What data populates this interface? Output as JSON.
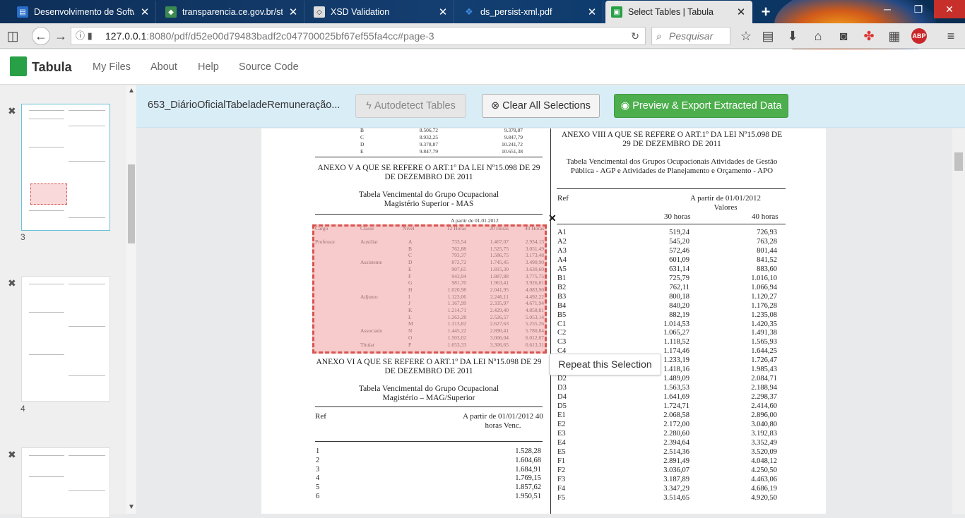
{
  "browser": {
    "tabs": [
      {
        "title": "Desenvolvimento de Softwa",
        "close": "✕"
      },
      {
        "title": "transparencia.ce.gov.br/stat",
        "close": "✕"
      },
      {
        "title": "XSD Validation",
        "close": "✕"
      },
      {
        "title": "ds_persist-xml.pdf",
        "close": "✕"
      },
      {
        "title": "Select Tables | Tabula",
        "close": "✕"
      }
    ],
    "new_tab": "+",
    "url_host": "127.0.0.1",
    "url_rest": ":8080/pdf/d52e00d79483badf2c047700025bf67ef55fa4cc#page-3",
    "search_placeholder": "Pesquisar",
    "abp": "ABP"
  },
  "app": {
    "brand": "Tabula",
    "menu": [
      "My Files",
      "About",
      "Help",
      "Source Code"
    ]
  },
  "toolbar": {
    "filename": "653_DiárioOficialTabeladeRemuneração...",
    "autodetect": "Autodetect Tables",
    "clear": "Clear All Selections",
    "export": "Preview & Export Extracted Data"
  },
  "sidebar": {
    "pages": [
      "3",
      "4"
    ]
  },
  "selection": {
    "close": "✕",
    "repeat": "Repeat this Selection"
  },
  "doc": {
    "left": {
      "top_rows": [
        [
          "B",
          "8.506,72",
          "9.378,87"
        ],
        [
          "C",
          "8.932,25",
          "9.847,79"
        ],
        [
          "D",
          "9.378,87",
          "10.241,72"
        ],
        [
          "E",
          "9.847,79",
          "10.651,38"
        ]
      ],
      "annex5_title": "ANEXO V A QUE SE REFERE O ART.1º DA LEI Nº15.098 DE 29 DE DEZEMBRO DE 2011",
      "annex5_sub": "Tabela Vencimental do Grupo Ocupacional Magistério Superior - MAS",
      "date_label": "A partir de 01.01.2012",
      "mas_headers": [
        "Cargo",
        "Classe",
        "Nível",
        "12 Horas",
        "20 Horas",
        "40 Horas"
      ],
      "mas_rows": [
        [
          "Professor",
          "Auxiliar",
          "A",
          "733,54",
          "1.467,07",
          "2.934,13"
        ],
        [
          "",
          "",
          "B",
          "762,88",
          "1.525,75",
          "3.051,49"
        ],
        [
          "",
          "",
          "C",
          "793,37",
          "1.586,75",
          "3.173,48"
        ],
        [
          "",
          "Assistente",
          "D",
          "872,72",
          "1.745,45",
          "3.490,90"
        ],
        [
          "",
          "",
          "E",
          "907,65",
          "1.815,30",
          "3.630,60"
        ],
        [
          "",
          "",
          "F",
          "943,94",
          "1.887,88",
          "3.775,75"
        ],
        [
          "",
          "",
          "G",
          "981,70",
          "1.963,41",
          "3.926,81"
        ],
        [
          "",
          "",
          "H",
          "1.020,98",
          "2.041,95",
          "4.083,90"
        ],
        [
          "",
          "Adjunto",
          "I",
          "1.123,06",
          "2.246,11",
          "4.492,22"
        ],
        [
          "",
          "",
          "J",
          "1.167,99",
          "2.335,97",
          "4.671,94"
        ],
        [
          "",
          "",
          "K",
          "1.214,71",
          "2.429,40",
          "4.858,81"
        ],
        [
          "",
          "",
          "L",
          "1.263,28",
          "2.526,57",
          "5.053,14"
        ],
        [
          "",
          "",
          "M",
          "1.313,82",
          "2.627,63",
          "5.255,26"
        ],
        [
          "",
          "Associado",
          "N",
          "1.445,22",
          "2.890,41",
          "5.780,84"
        ],
        [
          "",
          "",
          "O",
          "1.503,02",
          "3.006,04",
          "6.012,07"
        ],
        [
          "",
          "Titular",
          "P",
          "1.653,33",
          "3.306,65",
          "6.613,31"
        ]
      ],
      "annex6_title": "ANEXO VI A QUE SE REFERE O ART.1º DA LEI Nº15.098 DE 29 DE DEZEMBRO DE 2011",
      "annex6_sub": "Tabela Vencimental do Grupo Ocupacional Magistério – MAG/Superior",
      "mag_ref": "Ref",
      "mag_head": "A partir de 01/01/2012 40 horas Venc.",
      "mag_rows": [
        [
          "1",
          "1.528,28"
        ],
        [
          "2",
          "1.604,68"
        ],
        [
          "3",
          "1.684,91"
        ],
        [
          "4",
          "1.769,15"
        ],
        [
          "5",
          "1.857,62"
        ],
        [
          "6",
          "1.950,51"
        ]
      ]
    },
    "right": {
      "annex8_title": "ANEXO VIII A QUE SE REFERE O ART.1º DA LEI Nº15.098 DE 29 DE DEZEMBRO DE 2011",
      "annex8_sub": "Tabela Vencimental dos Grupos Ocupacionais Atividades de Gestão Pública - AGP e Atividades de Planejamento e Orçamento - APO",
      "ref": "Ref",
      "head1": "A partir de 01/01/2012",
      "head2": "Valores",
      "h30": "30 horas",
      "h40": "40 horas",
      "rows": [
        [
          "A1",
          "519,24",
          "726,93"
        ],
        [
          "A2",
          "545,20",
          "763,28"
        ],
        [
          "A3",
          "572,46",
          "801,44"
        ],
        [
          "A4",
          "601,09",
          "841,52"
        ],
        [
          "A5",
          "631,14",
          "883,60"
        ],
        [
          "B1",
          "725,79",
          "1.016,10"
        ],
        [
          "B2",
          "762,11",
          "1.066,94"
        ],
        [
          "B3",
          "800,18",
          "1.120,27"
        ],
        [
          "B4",
          "840,20",
          "1.176,28"
        ],
        [
          "B5",
          "882,19",
          "1.235,08"
        ],
        [
          "C1",
          "1.014,53",
          "1.420,35"
        ],
        [
          "C2",
          "1.065,27",
          "1.491,38"
        ],
        [
          "C3",
          "1.118,52",
          "1.565,93"
        ],
        [
          "C4",
          "1.174,46",
          "1.644,25"
        ],
        [
          "C5",
          "1.233,19",
          "1.726,47"
        ],
        [
          "D1",
          "1.418,16",
          "1.985,43"
        ],
        [
          "D2",
          "1.489,09",
          "2.084,71"
        ],
        [
          "D3",
          "1.563,53",
          "2.188,94"
        ],
        [
          "D4",
          "1.641,69",
          "2.298,37"
        ],
        [
          "D5",
          "1.724,71",
          "2.414,60"
        ],
        [
          "E1",
          "2.068,58",
          "2.896,00"
        ],
        [
          "E2",
          "2.172,00",
          "3.040,80"
        ],
        [
          "E3",
          "2.280,60",
          "3.192,83"
        ],
        [
          "E4",
          "2.394,64",
          "3.352,49"
        ],
        [
          "E5",
          "2.514,36",
          "3.520,09"
        ],
        [
          "F1",
          "2.891,49",
          "4.048,12"
        ],
        [
          "F2",
          "3.036,07",
          "4.250,50"
        ],
        [
          "F3",
          "3.187,89",
          "4.463,06"
        ],
        [
          "F4",
          "3.347,29",
          "4.686,19"
        ],
        [
          "F5",
          "3.514,65",
          "4.920,50"
        ]
      ]
    }
  },
  "colors": {
    "tab_bar": "#143e70",
    "toolbar_bg": "#d9edf7",
    "export_green": "#4cae4c",
    "selection_border": "#d9534f",
    "brand_green": "#27a046"
  }
}
